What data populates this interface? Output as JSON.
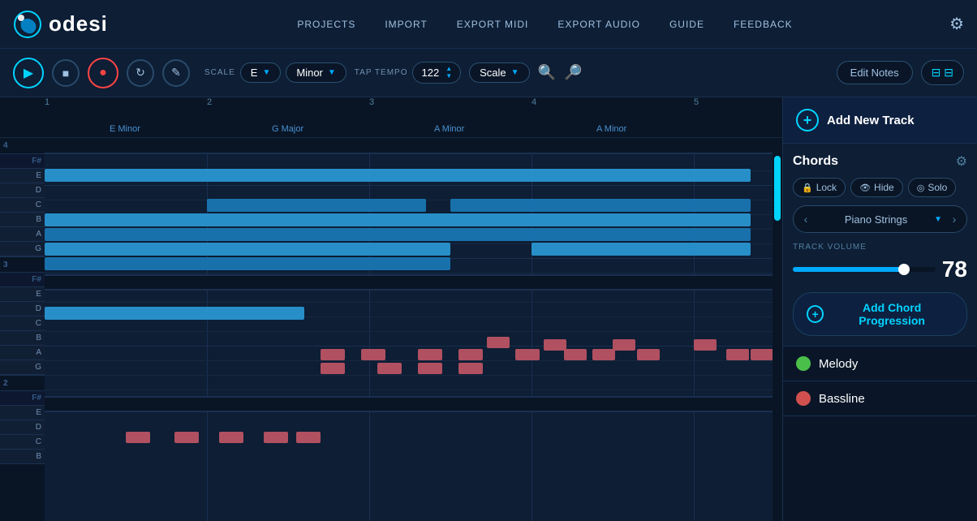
{
  "header": {
    "logo_text": "odesi",
    "nav_items": [
      "PROJECTS",
      "IMPORT",
      "EXPORT MIDI",
      "EXPORT AUDIO",
      "GUIDE",
      "FEEDBACK"
    ]
  },
  "toolbar": {
    "scale_label": "SCALE",
    "scale_key": "E",
    "scale_type": "Minor",
    "tap_tempo_label": "TAP TEMPO",
    "tempo_value": "122",
    "view_label": "Scale",
    "edit_notes_label": "Edit Notes"
  },
  "timeline": {
    "markers": [
      "1",
      "2",
      "3",
      "4",
      "5"
    ],
    "chord_labels": [
      {
        "label": "E Minor",
        "pos": 120
      },
      {
        "label": "G Major",
        "pos": 320
      },
      {
        "label": "A Minor",
        "pos": 520
      },
      {
        "label": "A Minor",
        "pos": 720
      }
    ]
  },
  "right_panel": {
    "add_track_label": "Add New Track",
    "chords_label": "Chords",
    "lock_label": "Lock",
    "hide_label": "Hide",
    "solo_label": "Solo",
    "instrument_label": "Piano Strings",
    "track_volume_label": "TRACK VOLUME",
    "track_volume_value": "78",
    "add_chord_label": "Add Chord Progression",
    "tracks": [
      {
        "name": "Melody",
        "color": "#4ac04a"
      },
      {
        "name": "Bassline",
        "color": "#d05050"
      }
    ]
  },
  "piano_keys": [
    {
      "note": "F#",
      "type": "black"
    },
    {
      "note": "E",
      "type": "white"
    },
    {
      "note": "D",
      "type": "white"
    },
    {
      "note": "C",
      "type": "white"
    },
    {
      "note": "B",
      "type": "white"
    },
    {
      "note": "A",
      "type": "white"
    },
    {
      "note": "G",
      "type": "white"
    },
    {
      "note": "F#",
      "type": "black"
    },
    {
      "note": "E",
      "type": "white"
    },
    {
      "note": "D",
      "type": "white"
    },
    {
      "note": "C",
      "type": "white"
    },
    {
      "note": "B",
      "type": "white"
    },
    {
      "note": "A",
      "type": "white"
    },
    {
      "note": "G",
      "type": "white"
    },
    {
      "note": "F#",
      "type": "black"
    },
    {
      "note": "E",
      "type": "white"
    },
    {
      "note": "D",
      "type": "white"
    },
    {
      "note": "C",
      "type": "white"
    },
    {
      "note": "B",
      "type": "white"
    }
  ]
}
